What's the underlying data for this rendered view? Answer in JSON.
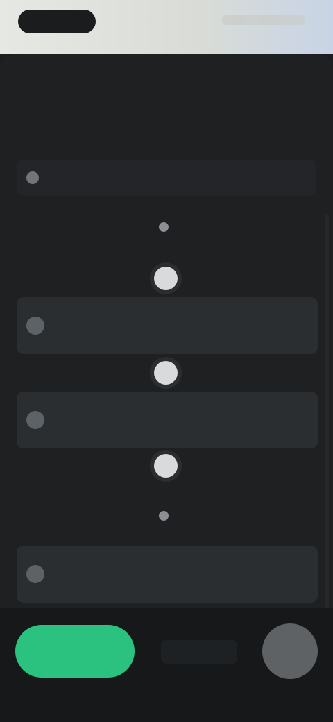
{
  "status_bar": {
    "time": "",
    "indicators": ""
  },
  "tabs": [
    {
      "label": ""
    },
    {
      "label": ""
    },
    {
      "label": ""
    }
  ],
  "header": {
    "left_label": "",
    "right_label": ""
  },
  "location_row": {
    "text": "",
    "highlight": "",
    "icon": "pin-icon"
  },
  "timeline": {
    "day_labels": [
      "",
      ""
    ],
    "cards": [
      {
        "title": "",
        "subtitle": "",
        "meta": "",
        "icon": "place-icon"
      },
      {
        "title": "",
        "subtitle": "",
        "meta": "",
        "icon": "place-icon"
      },
      {
        "title": "",
        "subtitle": "",
        "meta": "",
        "icon": "place-icon"
      }
    ]
  },
  "bottom_bar": {
    "primary_label": "",
    "secondary_label": "",
    "avatar_icon": "avatar-icon"
  },
  "colors": {
    "accent": "#2bc27f",
    "link": "#4290b8",
    "background": "#1e2022",
    "card": "#2b2e31"
  }
}
